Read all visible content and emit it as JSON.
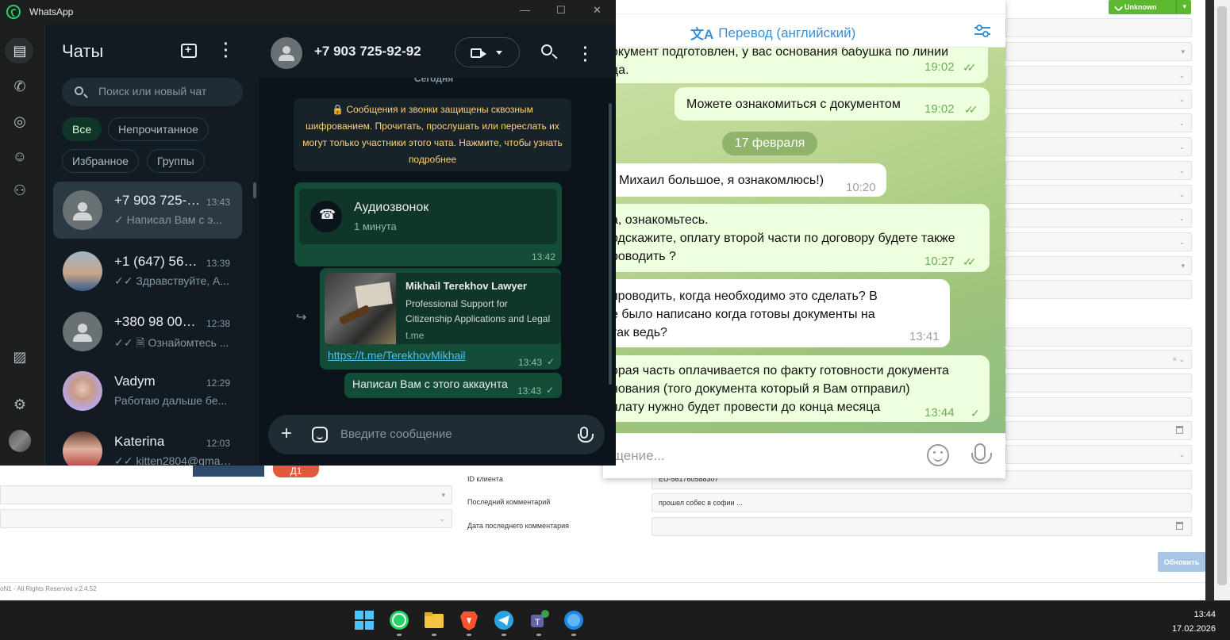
{
  "crm": {
    "unknown_button": "Unknown",
    "labels": {
      "client_id": "ID клиента",
      "last_comment": "Последний комментарий",
      "last_comment_date": "Дата последнего комментария"
    },
    "values": {
      "client_id": "EU-561760588307",
      "last_comment": "прошел собес в софии ..."
    },
    "update_button": "Обновить",
    "footer": "oN1 - All Rights Reserved v.2.4.52",
    "red_pill": "Д1"
  },
  "telegram": {
    "translate_label": "Перевод (английский)",
    "input_placeholder": "щение...",
    "date_pill": "17 февраля",
    "messages": [
      {
        "text": "окумент подготовлен, у вас основания бабушка по линии\nца.",
        "time": "19:02",
        "dir": "out"
      },
      {
        "text": "Можете ознакомиться с документом",
        "time": "19:02",
        "dir": "out"
      },
      {
        "text": "Михаил большое, я ознакомлюсь!)",
        "time": "10:20",
        "dir": "in"
      },
      {
        "text": "а, ознакомьтесь.\nодскажите, оплату второй части по договору будете также\nроводить ?",
        "time": "10:27",
        "dir": "out"
      },
      {
        "text": "проводить, когда необходимо это сделать? В\nе было написано когда готовы документы на\nтак ведь?",
        "time": "13:41",
        "dir": "in"
      },
      {
        "text": "орая часть оплачивается по факту готовности документа\nнования (того документа который я Вам отправил)\nплату нужно будет провести до конца месяца",
        "time": "13:44",
        "dir": "out"
      }
    ]
  },
  "whatsapp": {
    "app_title": "WhatsApp",
    "list_title": "Чаты",
    "search_placeholder": "Поиск или новый чат",
    "filters": [
      "Все",
      "Непрочитанное",
      "Избранное",
      "Группы"
    ],
    "chats": [
      {
        "name": "+7 903 725-9...",
        "time": "13:43",
        "preview": "✓ Написал Вам с э..."
      },
      {
        "name": "+1 (647) 561-...",
        "time": "13:39",
        "preview": "✓✓ Здравствуйте, А..."
      },
      {
        "name": "+380 98 007 ...",
        "time": "12:38",
        "preview": "✓✓ 🗎 Ознайомтесь ..."
      },
      {
        "name": "Vadym",
        "time": "12:29",
        "preview": "Работаю дальше бе..."
      },
      {
        "name": "Katerina",
        "time": "12:03",
        "preview": "✓✓ kitten2804@gmai..."
      }
    ],
    "convo": {
      "contact": "+7 903 725-92-92",
      "today": "Сегодня",
      "e2e_notice": "🔒 Сообщения и звонки защищены сквозным шифрованием. Прочитать, прослушать или переслать их могут только участники этого чата. Нажмите, чтобы узнать подробнее",
      "audio_title": "Аудиозвонок",
      "audio_duration": "1 минута",
      "audio_time": "13:42",
      "link_title": "Mikhail Terekhov Lawyer",
      "link_desc": "Professional Support for Citizenship Applications and Legal",
      "link_domain": "t.me",
      "link_url": "https://t.me/TerekhovMikhail",
      "link_time": "13:43",
      "text_msg": "Написал Вам с этого аккаунта",
      "text_time": "13:43",
      "composer_placeholder": "Введите сообщение"
    }
  },
  "taskbar": {
    "time": "13:44",
    "date": "17.02.2026"
  }
}
